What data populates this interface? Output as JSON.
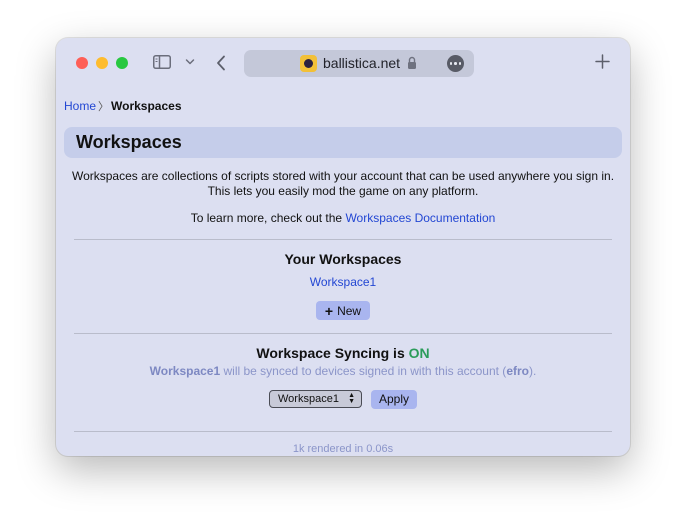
{
  "browser": {
    "url": "ballistica.net",
    "icons": [
      "sidebar-icon",
      "chevron-down-icon",
      "back-icon",
      "favicon",
      "lock-icon",
      "more-icon",
      "new-tab-icon"
    ]
  },
  "breadcrumb": {
    "home": "Home",
    "current": "Workspaces"
  },
  "page": {
    "title": "Workspaces",
    "description_line1": "Workspaces are collections of scripts stored with your account that can be used anywhere you sign in.",
    "description_line2": "This lets you easily mod the game on any platform.",
    "learn_prefix": "To learn more, check out the ",
    "learn_link": "Workspaces Documentation"
  },
  "workspaces": {
    "heading": "Your Workspaces",
    "items": [
      "Workspace1"
    ],
    "new_button": "New"
  },
  "sync": {
    "heading_prefix": "Workspace Syncing is ",
    "status": "ON",
    "status_color": "#2b9c5a",
    "workspace": "Workspace1",
    "middle_text": " will be synced to devices signed in with this account (",
    "account": "efro",
    "suffix": ").",
    "select_value": "Workspace1",
    "apply_button": "Apply"
  },
  "footer": {
    "text": "1k rendered in 0.06s"
  }
}
